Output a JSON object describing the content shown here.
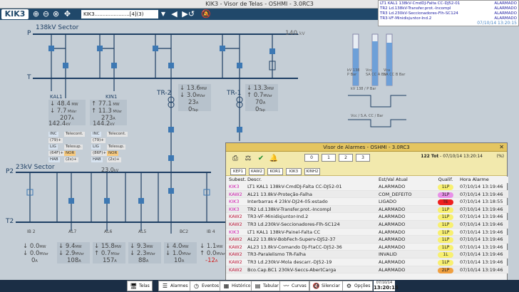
{
  "window": {
    "title": "KIK3 - Visor de Telas - OSHMI - 3.0RC3",
    "controls": "— ▢ ✕"
  },
  "toolbar": {
    "logo": "KIK3",
    "screen_select": "KIK3......................[4](3)",
    "icons": [
      "zoom-in-icon",
      "zoom-out-icon",
      "zoom-fit-icon",
      "pan-icon",
      "back-icon",
      "forward-icon",
      "history-icon",
      "bell-off-icon"
    ]
  },
  "alarm_strip": {
    "rows": [
      {
        "text": "LT1 KAL1 138kV-CmdDJ-Falta CC-DJ52-01",
        "status": "ALARMADO"
      },
      {
        "text": "TR2 Ld.138kV-Transfer.prot.-Incompl",
        "status": "ALARMADO"
      },
      {
        "text": "TR3 Ld.230kV-Seccionadores-Flh-SC124",
        "status": "ALARMADO"
      },
      {
        "text": "TR3-VF-Minidisjuntor-Ind.2",
        "status": "ALARMADO"
      }
    ],
    "datetime": "07/10/14 13:20:15"
  },
  "diagram": {
    "bus_138": "138kV Sector",
    "bus_p": "P",
    "bus_t": "T",
    "bus_23": "23kV Sector",
    "bus_p2": "P2",
    "bus_t2": "T2",
    "bus_23_value": "23.0",
    "bus_23_unit": "kV",
    "gen_value": "140.",
    "gen_unit": "kV",
    "kal1": {
      "name": "KAL1",
      "mw": "48.4",
      "mvar": "7.7",
      "amp": "207",
      "kv": "142.4"
    },
    "kin1": {
      "name": "KIN1",
      "mw": "77.1",
      "mvar": "11.3",
      "amp": "273",
      "kv": "144.2"
    },
    "tr2": {
      "name": "TR-2",
      "mw": "13.6",
      "mvar": "3.0",
      "amp": "23",
      "tap": "0"
    },
    "tr1": {
      "name": "TR-1",
      "mw": "13.3",
      "mvar": "0.7",
      "amp": "70",
      "tap": "0"
    },
    "tags": {
      "inc": "INC",
      "telecont": "Telecont.",
      "lig": "LIG",
      "telesup": "Telesup.",
      "nor": "NOR",
      "hab": "HAB",
      "kal1_rec": "(79)+",
      "kal1_ov": "(64F)+",
      "kal1_hab": "(2x)+",
      "kin1_rec": "(79)+",
      "kin1_ov": "(86F)+",
      "kin1_hab": "(2x)+"
    },
    "feeders": [
      {
        "name": "IB 2",
        "mw": "0.0",
        "mvar": "0.0",
        "amp": "0"
      },
      {
        "name": "AL7",
        "mw": "9.4",
        "mvar": "2.9",
        "amp": "108"
      },
      {
        "name": "AL6",
        "mw": "15.8",
        "mvar": "0.7",
        "amp": "157"
      },
      {
        "name": "AL5",
        "mw": "9.3",
        "mvar": "2.3",
        "amp": "88"
      },
      {
        "name": "BC2",
        "mw": "4.0",
        "mvar": "1.0",
        "amp": "10"
      },
      {
        "name": "IB 4",
        "mw": "1.1",
        "mvar": "0.0",
        "amp": "-12"
      }
    ],
    "gauges": [
      {
        "label": "kV 138",
        "sub": "P Bar"
      },
      {
        "label": "Vcc",
        "sub": "SA CC A Bar"
      },
      {
        "label": "Vca",
        "sub": "SA CC B Bar"
      }
    ],
    "vac_label": "kV 138 / P Bar",
    "vcc_label": "Vcc / S.A. CC / Bar"
  },
  "alarm_window": {
    "title": "Visor de Alarmes - OSHMI - 3.0RC3",
    "summary_count": "122 Tot",
    "summary_time": "- 07/10/14 13:20:14",
    "percent": "(%)",
    "counts": [
      "0",
      "1",
      "2",
      "3"
    ],
    "stations": [
      "KEP1",
      "KAW2",
      "KOR1",
      "KIK3",
      "KINH2"
    ],
    "columns": {
      "sub": "Subest.",
      "descr": "Descr.",
      "status": "Est/Val Atual",
      "qual": "Qualif.",
      "time": "Hora Alarme"
    },
    "rows": [
      {
        "sub": "KIK3",
        "descr": "LT1 KAL1 138kV-CmdDJ-Falta CC-DJ52-01",
        "status": "ALARMADO",
        "qual": "1LP",
        "qual_color": "#f8f070",
        "time": "07/10/14 13:19:46",
        "sub_color": "#d020b0"
      },
      {
        "sub": "KAW2",
        "descr": "AL21 13.8kV-Proteção-Falha",
        "status": "COM_DEFEITO",
        "qual": "3LP",
        "qual_color": "#e890e8",
        "time": "07/10/14 13:19:46",
        "sub_color": "#d020b0"
      },
      {
        "sub": "KIK3",
        "descr": "Interbarras 4 23kV-DJ24-05:estado",
        "status": "LIGADO",
        "qual": "TE",
        "qual_color": "#ee2020",
        "time": "07/10/14 13:18:55",
        "sub_color": "#d020b0"
      },
      {
        "sub": "KIK3",
        "descr": "TR2 Ld.138kV-Transfer.prot.-Incompl",
        "status": "ALARMADO",
        "qual": "1LP",
        "qual_color": "#f8f070",
        "time": "07/10/14 13:19:46",
        "sub_color": "#d020b0"
      },
      {
        "sub": "KAW2",
        "descr": "TR3-VF-Minidisjuntor-Ind.2",
        "status": "ALARMADO",
        "qual": "1LP",
        "qual_color": "#f8f070",
        "time": "07/10/14 13:19:46",
        "sub_color": "#c02040"
      },
      {
        "sub": "KAW2",
        "descr": "TR3 Ld.230kV-Seccionadores-Flh-SC124",
        "status": "ALARMADO",
        "qual": "1LP",
        "qual_color": "#f8f070",
        "time": "07/10/14 13:19:46",
        "sub_color": "#c02040"
      },
      {
        "sub": "KIK3",
        "descr": "LT1 KAL1 138kV-Painel-Falta CC",
        "status": "ALARMADO",
        "qual": "1LP",
        "qual_color": "#f8f070",
        "time": "07/10/14 13:19:46",
        "sub_color": "#d020b0"
      },
      {
        "sub": "KAW2",
        "descr": "AL22 13.8kV-BobFech-Superv-DJ52-37",
        "status": "ALARMADO",
        "qual": "1LP",
        "qual_color": "#f8f070",
        "time": "07/10/14 13:19:46",
        "sub_color": "#c02040"
      },
      {
        "sub": "KAW2",
        "descr": "AL23 13.8kV-Comando DJ-FtaCC-DJ52-36",
        "status": "ALARMADO",
        "qual": "1LP",
        "qual_color": "#f8f070",
        "time": "07/10/14 13:19:46",
        "sub_color": "#c02040"
      },
      {
        "sub": "KAW2",
        "descr": "TR3-Paralelismo TR-Falha",
        "status": "INVALID",
        "qual": "1L",
        "qual_color": "#f8f070",
        "time": "07/10/14 13:19:46",
        "sub_color": "#c02040"
      },
      {
        "sub": "KAW2",
        "descr": "TR3 Ld.230kV-Mola descarr.-DJ52-19",
        "status": "ALARMADO",
        "qual": "1LP",
        "qual_color": "#f8f070",
        "time": "07/10/14 13:19:46",
        "sub_color": "#c02040"
      },
      {
        "sub": "KAW2",
        "descr": "Bco.Cap.BC1 230kV-Seccs-AbertCarga",
        "status": "ALARMADO",
        "qual": "2LP",
        "qual_color": "#f0a040",
        "time": "07/10/14 13:19:46",
        "sub_color": "#c02040"
      }
    ]
  },
  "bottom_bar": {
    "buttons": [
      {
        "label": "Telas",
        "icon": "monitor-icon"
      },
      {
        "label": "Alarmes",
        "icon": "alarm-list-icon"
      },
      {
        "label": "Eventos",
        "icon": "clock-icon"
      },
      {
        "label": "Histórico",
        "icon": "chart-icon"
      },
      {
        "label": "Tabular",
        "icon": "table-icon"
      },
      {
        "label": "Curvas",
        "icon": "curves-icon"
      },
      {
        "label": "Silenciar",
        "icon": "mute-icon"
      },
      {
        "label": "Opções",
        "icon": "options-icon"
      }
    ],
    "clock_date": "07/10/14",
    "clock_time": "13:20:15"
  },
  "colors": {
    "toolbar": "#20486a",
    "bus": "#1d3e63",
    "breaker": "#3d78b3",
    "alarm_title": "#e4c560"
  }
}
